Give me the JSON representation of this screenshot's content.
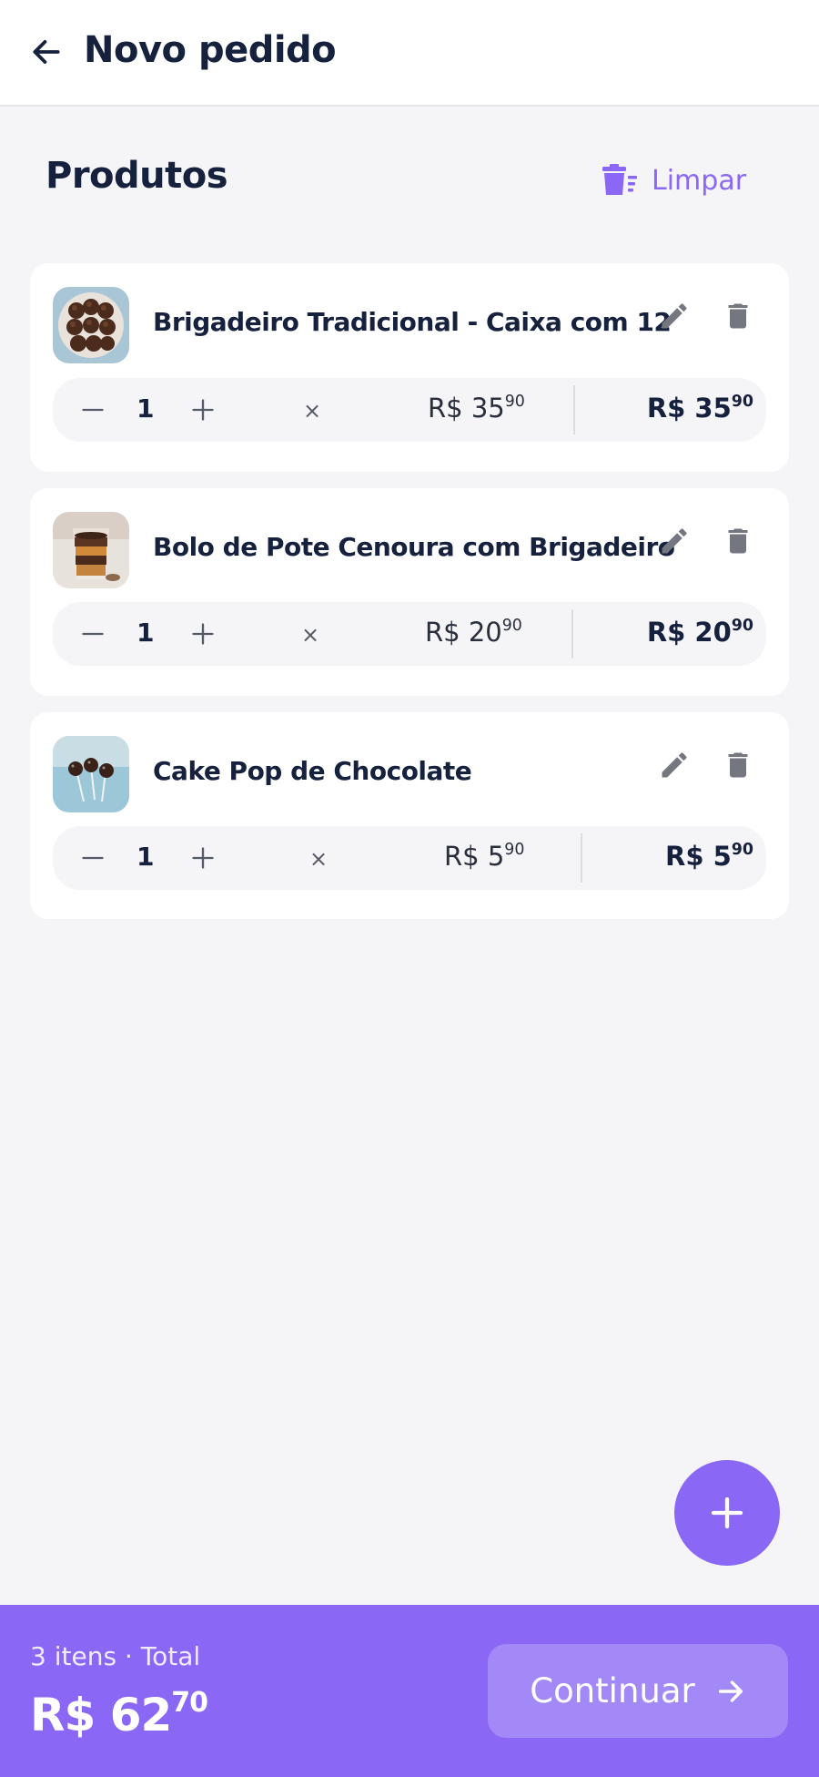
{
  "header": {
    "title": "Novo pedido",
    "back_icon": "arrow-left-icon"
  },
  "products_section": {
    "title": "Produtos",
    "clear_label": "Limpar",
    "clear_icon": "trash-list-icon"
  },
  "items": [
    {
      "name": "Brigadeiro Tradicional - Caixa com 12",
      "image": "brigadeiro-box-image",
      "quantity": "1",
      "times": "×",
      "unit_price_main": "R$ 35",
      "unit_price_cents": "90",
      "total_main": "R$ 35",
      "total_cents": "90"
    },
    {
      "name": "Bolo de Pote Cenoura com Brigadeiro",
      "image": "bolo-de-pote-image",
      "quantity": "1",
      "times": "×",
      "unit_price_main": "R$ 20",
      "unit_price_cents": "90",
      "total_main": "R$ 20",
      "total_cents": "90"
    },
    {
      "name": "Cake Pop de Chocolate",
      "image": "cake-pop-image",
      "quantity": "1",
      "times": "×",
      "unit_price_main": "R$ 5",
      "unit_price_cents": "90",
      "total_main": "R$ 5",
      "total_cents": "90"
    }
  ],
  "fab": {
    "icon": "plus-icon"
  },
  "footer": {
    "summary": "3 itens · Total",
    "total_main": "R$ 62",
    "total_cents": "70",
    "continue_label": "Continuar",
    "continue_icon": "arrow-right-icon"
  },
  "colors": {
    "accent": "#8b67f5",
    "background": "#f5f5f8",
    "text": "#16213e"
  }
}
